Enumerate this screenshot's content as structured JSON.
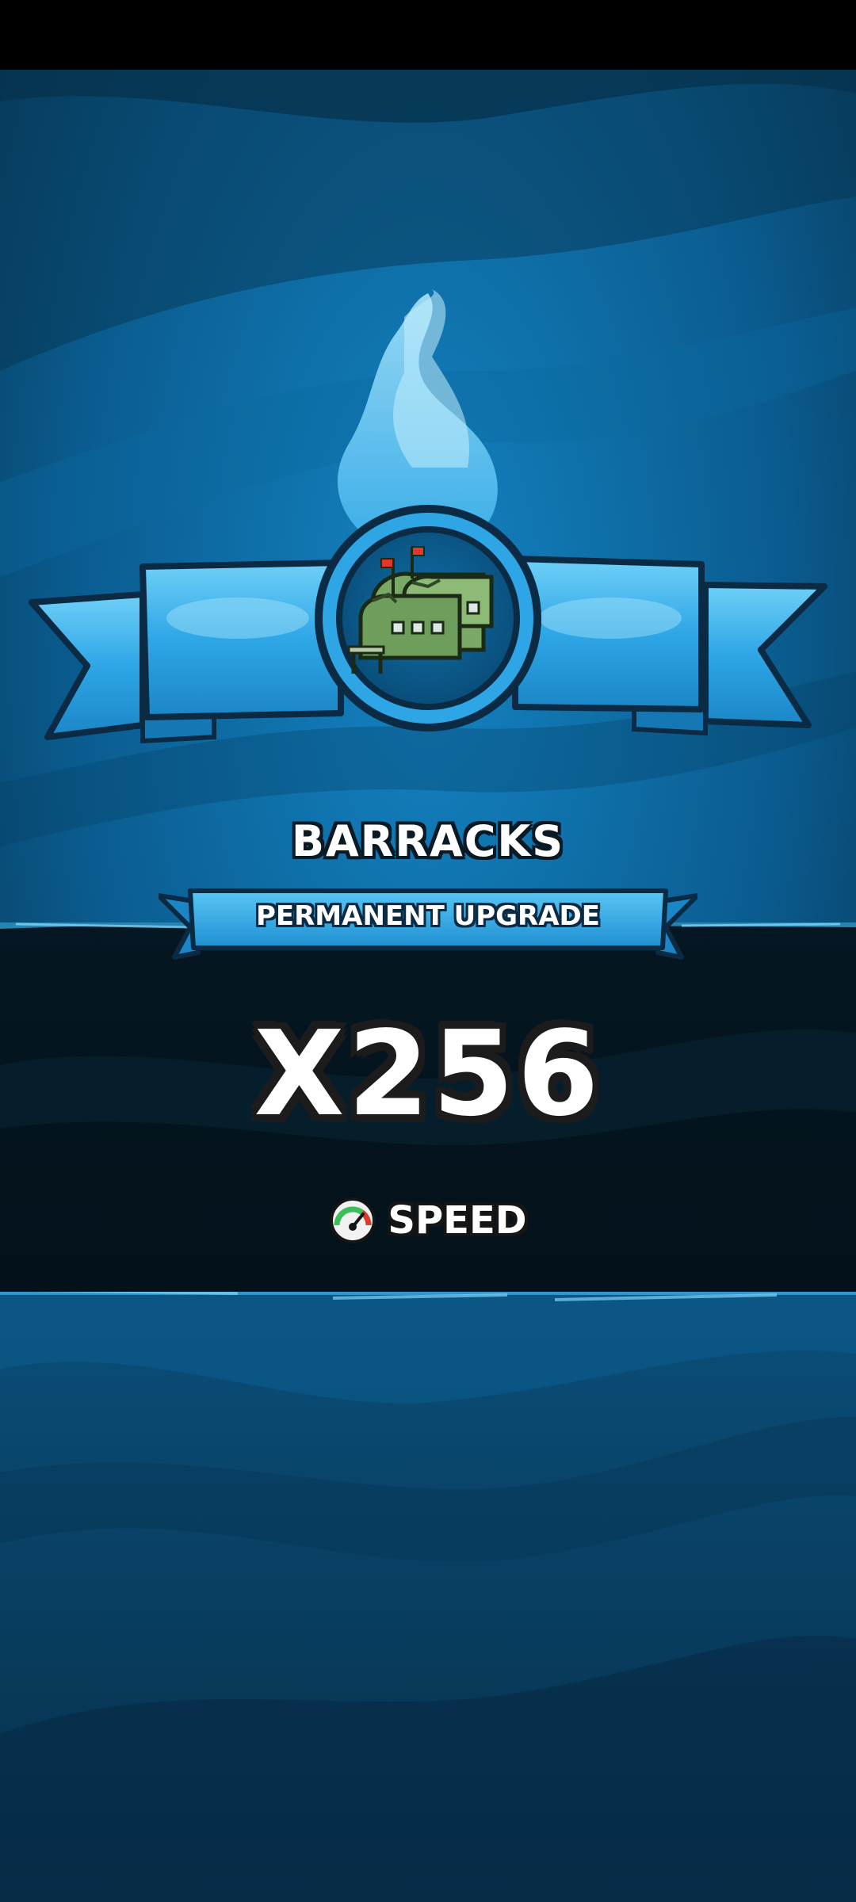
{
  "reward": {
    "building_name": "BARRACKS",
    "upgrade_type": "PERMANENT UPGRADE",
    "multiplier": "X256",
    "stat_label": "SPEED",
    "icon": "barracks-building-icon",
    "stat_icon": "speedometer-icon"
  },
  "colors": {
    "background_blue": "#0b5f90",
    "background_deep": "#072f48",
    "dark_band": "#04131c",
    "ribbon_blue": "#2ea6e6",
    "ribbon_outline": "#0b2a44",
    "flame_blue": "#5cc4f2",
    "text_white": "#ffffff",
    "speed_green": "#3cbf5a"
  }
}
